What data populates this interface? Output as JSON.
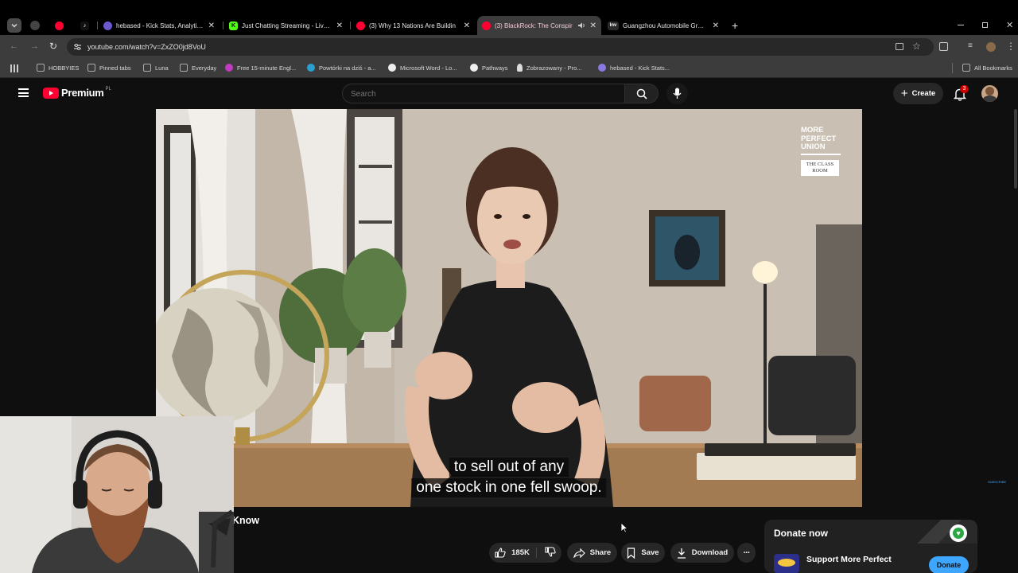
{
  "browser": {
    "tabs": [
      {
        "title": "",
        "icon": "youtube-icon",
        "color": "#ff0033"
      },
      {
        "title": "",
        "icon": "tiktok-icon",
        "color": "#000000"
      },
      {
        "title": "hebased - Kick Stats, Analytics a",
        "icon": "kick-stats-icon",
        "color": "#6a5acd"
      },
      {
        "title": "Just Chatting Streaming - Live S",
        "icon": "kick-icon",
        "color": "#53fc18"
      },
      {
        "title": "(3) Why 13 Nations Are Buildin",
        "icon": "youtube-icon",
        "color": "#ff0033"
      },
      {
        "title": "(3) BlackRock: The Conspir",
        "icon": "youtube-icon",
        "color": "#ff0033",
        "active": true
      },
      {
        "title": "Guangzhou Automobile Group",
        "icon": "inv-icon",
        "color": "#ffffff"
      }
    ],
    "new_tab_label": "+",
    "url": "youtube.com/watch?v=ZxZO0jd8VoU",
    "bookmarks": [
      "HOBBYIES",
      "Pinned tabs",
      "Luna",
      "Everyday",
      "Free 15-minute Engl...",
      "Powtórki na dziś - a...",
      "Microsoft Word - Lo...",
      "Pathways",
      "Zobrazowany - Pro...",
      "hebased - Kick Stats..."
    ],
    "all_bookmarks": "All Bookmarks"
  },
  "youtube": {
    "logo_text": "Premium",
    "region": "PL",
    "search_placeholder": "Search",
    "create_label": "Create",
    "notification_count": "3"
  },
  "video": {
    "watermark_lines": [
      "MORE",
      "PERFECT",
      "UNION"
    ],
    "watermark_sub": "THE CLASS ROOM",
    "caption_line1": "to sell out of any",
    "caption_line2": "one stock in one fell swoop.",
    "corner_badge": "SUBSCRIBE"
  },
  "below_video": {
    "title_fragment": "Know",
    "likes": "185K",
    "share_label": "Share",
    "save_label": "Save",
    "download_label": "Download",
    "more_label": "···"
  },
  "donate": {
    "title": "Donate now",
    "org": "Support More Perfect",
    "button_label": "Donate"
  },
  "colors": {
    "youtube_red": "#ff0033",
    "background": "#0f0f0f",
    "chrome_toolbar": "#3c3c3c"
  }
}
